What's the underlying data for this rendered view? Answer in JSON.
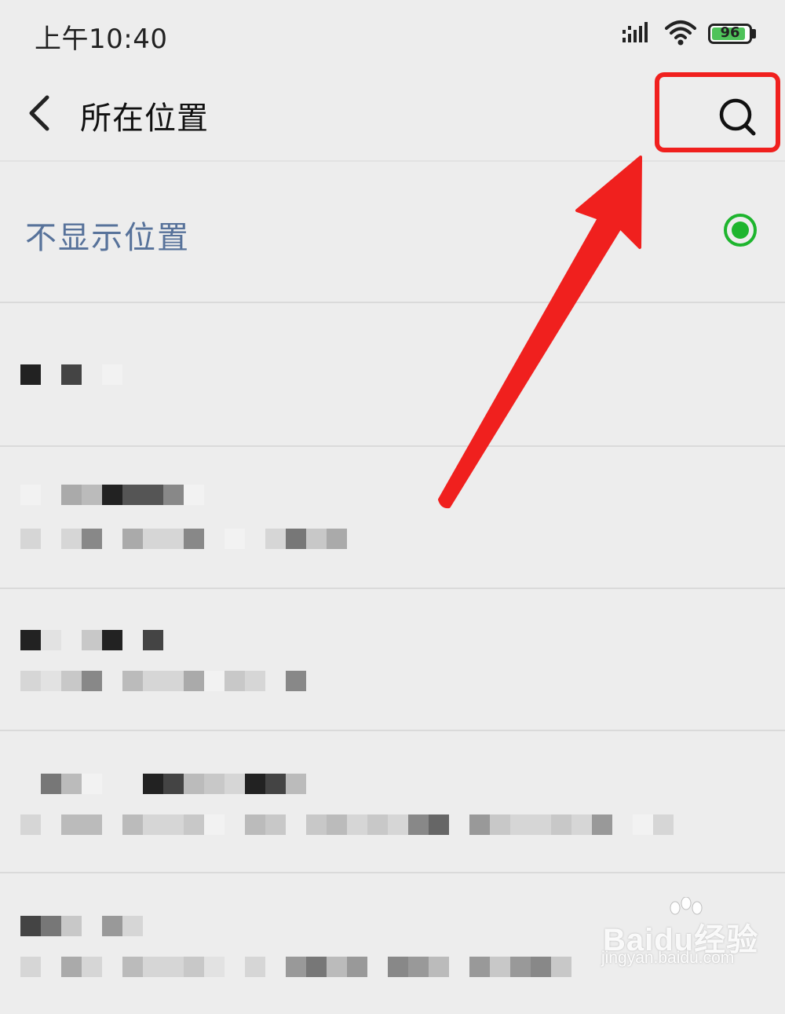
{
  "status_bar": {
    "time": "上午10:40",
    "battery_percent": 96,
    "battery_text": "96",
    "icons": [
      "signal-icon",
      "wifi-icon",
      "battery-icon"
    ]
  },
  "header": {
    "title": "所在位置",
    "back_icon": "chevron-left-icon",
    "search_icon": "search-icon"
  },
  "no_location": {
    "label": "不显示位置",
    "selected": true
  },
  "location_items": [
    {
      "title": "",
      "subtitle": ""
    },
    {
      "title": "",
      "subtitle": ""
    },
    {
      "title": "",
      "subtitle": ""
    },
    {
      "title": "",
      "subtitle": ""
    },
    {
      "title": "",
      "subtitle": ""
    }
  ],
  "annotation": {
    "highlight_color": "#f0201e",
    "arrow_color": "#f0201e"
  },
  "watermark": {
    "brand": "Baidu经验",
    "url": "jingyan.baidu.com"
  },
  "colors": {
    "background": "#ededed",
    "link_blue": "#57729a",
    "radio_green": "#1eb52e",
    "battery_green": "#4fc35a"
  }
}
